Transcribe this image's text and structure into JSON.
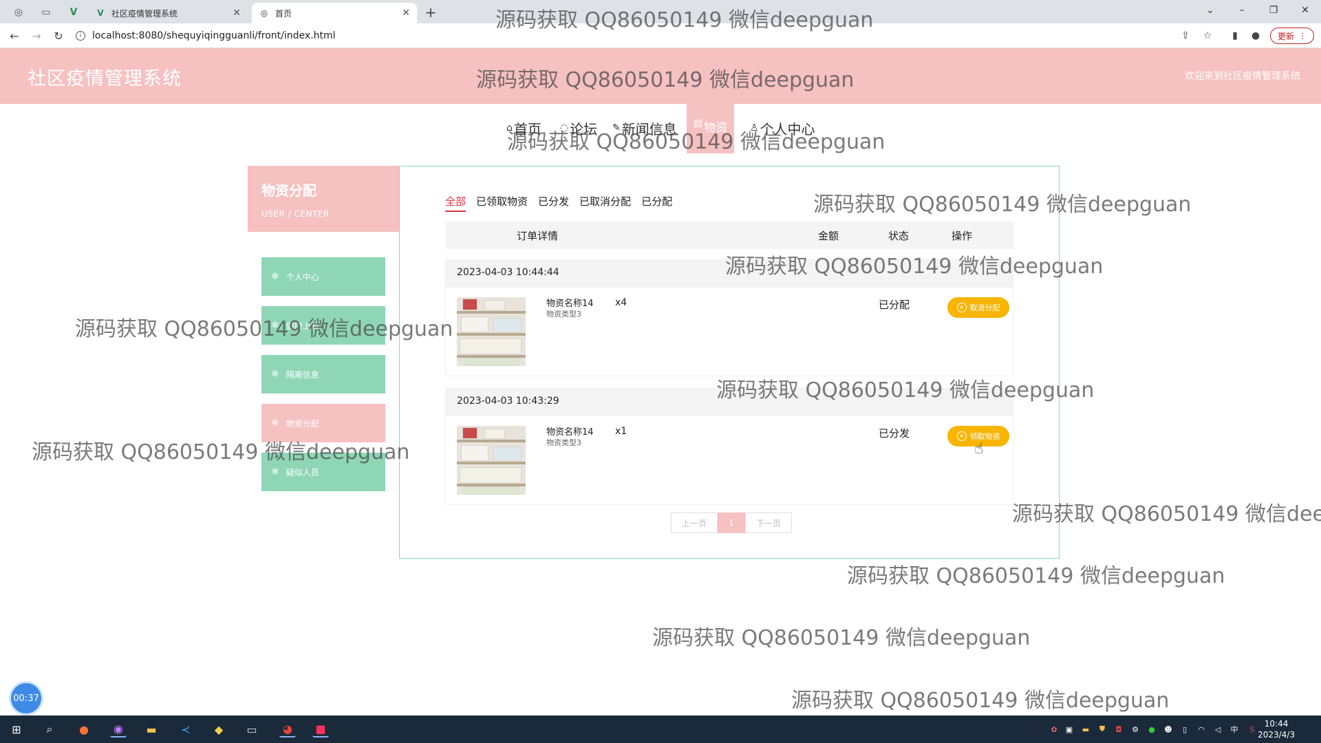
{
  "browser": {
    "tabs": [
      {
        "title": "社区疫情管理系统",
        "icon": "vue-logo-icon"
      },
      {
        "title": "首页",
        "icon": "globe-icon"
      }
    ],
    "url": "localhost:8080/shequyiqingguanli/front/index.html",
    "update_label": "更新"
  },
  "header": {
    "site_title": "社区疫情管理系统",
    "welcome": "欢迎来到社区疫情管理系统"
  },
  "nav": {
    "items": [
      {
        "label": "首页",
        "icon": "home-icon"
      },
      {
        "label": "论坛",
        "icon": "chat-icon"
      },
      {
        "label": "新闻信息",
        "icon": "tag-icon"
      },
      {
        "label": "物资",
        "icon": "box-icon",
        "active": true
      },
      {
        "label": "个人中心",
        "icon": "user-icon"
      }
    ]
  },
  "sidebar": {
    "title": "物资分配",
    "subtitle": "USER / CENTER",
    "items": [
      {
        "label": "个人中心"
      },
      {
        "label": "健康上报"
      },
      {
        "label": "隔离信息"
      },
      {
        "label": "物资分配",
        "active": true
      },
      {
        "label": "疑似人员"
      }
    ]
  },
  "filters": {
    "tabs": [
      {
        "label": "全部",
        "active": true
      },
      {
        "label": "已领取物资"
      },
      {
        "label": "已分发"
      },
      {
        "label": "已取消分配"
      },
      {
        "label": "已分配"
      }
    ]
  },
  "table": {
    "headers": {
      "detail": "订单详情",
      "amount": "金额",
      "status": "状态",
      "action": "操作"
    }
  },
  "orders": [
    {
      "time": "2023-04-03 10:44:44",
      "name": "物资名称14",
      "type": "物资类型3",
      "qty": "x4",
      "status": "已分配",
      "action": "取消分配"
    },
    {
      "time": "2023-04-03 10:43:29",
      "name": "物资名称14",
      "type": "物资类型3",
      "qty": "x1",
      "status": "已分发",
      "action": "领取物资"
    }
  ],
  "pagination": {
    "prev": "上一页",
    "current": "1",
    "next": "下一页"
  },
  "watermark": "源码获取 QQ86050149 微信deepguan",
  "timer": "00:37",
  "taskbar": {
    "time": "10:44",
    "date": "2023/4/3",
    "ime": "中"
  },
  "colors": {
    "brand_pink": "#f6c1c1",
    "mint": "#8fd6b6",
    "button_yellow": "#f7b500",
    "active_red": "#d9363e"
  }
}
